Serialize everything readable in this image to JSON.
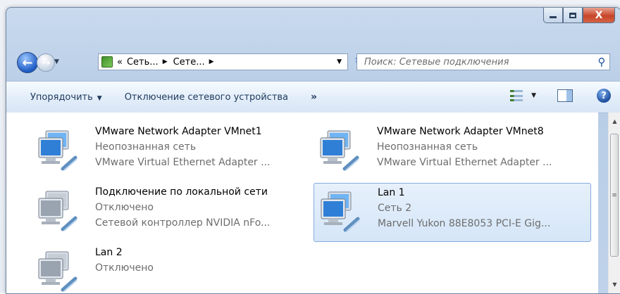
{
  "window": {
    "caption_close_glyph": "X"
  },
  "nav": {
    "back_glyph": "←",
    "forward_glyph": "→",
    "breadcrumbs": [
      "Сеть...",
      "Сете..."
    ],
    "overflow": "«",
    "separator": "▶",
    "search_placeholder": "Поиск: Сетевые подключения"
  },
  "toolbar": {
    "organize": "Упорядочить",
    "disable": "Отключение сетевого устройства",
    "more": "»"
  },
  "items": [
    {
      "name": "VMware Network Adapter VMnet1",
      "status": "Неопознанная сеть",
      "device": "VMware Virtual Ethernet Adapter ...",
      "selected": false,
      "connected": true
    },
    {
      "name": "VMware Network Adapter VMnet8",
      "status": "Неопознанная сеть",
      "device": "VMware Virtual Ethernet Adapter ...",
      "selected": false,
      "connected": true
    },
    {
      "name": "Подключение по локальной сети",
      "status": "Отключено",
      "device": "Сетевой контроллер NVIDIA nFo...",
      "selected": false,
      "connected": false
    },
    {
      "name": "Lan 1",
      "status": "Сеть  2",
      "device": "Marvell Yukon 88E8053 PCI-E Gig...",
      "selected": true,
      "connected": true
    },
    {
      "name": "Lan 2",
      "status": "Отключено",
      "device": "",
      "selected": false,
      "connected": false
    }
  ],
  "colors": {
    "selection_bg": "#d5e6f8",
    "selection_border": "#84acdd",
    "secondary_text": "#6d6d6d"
  }
}
